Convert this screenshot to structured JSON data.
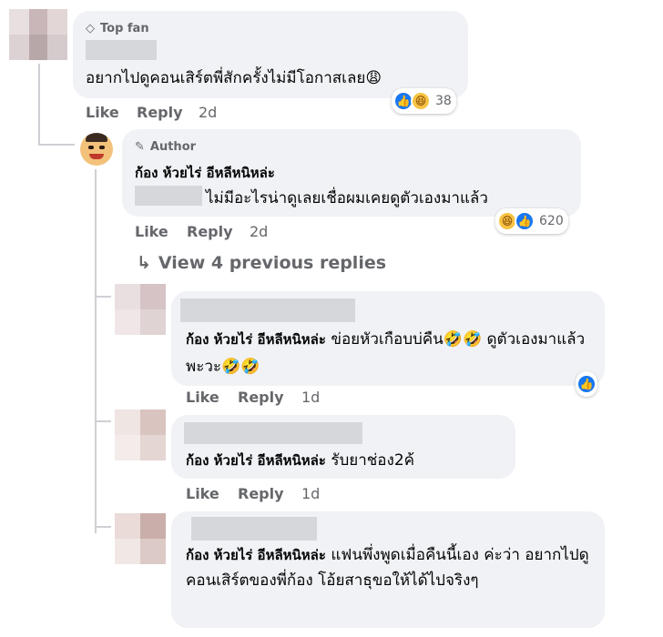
{
  "comments": [
    {
      "badge": "Top fan",
      "badge_icon": "diamond-icon",
      "text": "อยากไปดูคอนเสิร์ตพี่สักครั้งไม่มีโอกาสเลย😩",
      "reaction_count": "38",
      "reactions": [
        "like",
        "haha"
      ],
      "actions": {
        "like": "Like",
        "reply": "Reply",
        "time": "2d"
      }
    },
    {
      "badge": "Author",
      "badge_icon": "pencil-icon",
      "author": "ก้อง ห้วยไร่ อีหลีหนิหล่ะ",
      "text": "ไม่มีอะไรน่าดูเลยเชื่อผมเคยดูตัวเองมาแล้ว",
      "reaction_count": "620",
      "reactions": [
        "haha",
        "like"
      ],
      "actions": {
        "like": "Like",
        "reply": "Reply",
        "time": "2d"
      }
    }
  ],
  "view_previous": "View 4 previous replies",
  "replies": [
    {
      "mention": "ก้อง ห้วยไร่ อีหลีหนิหล่ะ",
      "text": "ข่อยหัวเกือบบ่คืน🤣🤣 ดูตัวเองมาแล้วพะวะ🤣🤣",
      "actions": {
        "like": "Like",
        "reply": "Reply",
        "time": "1d"
      },
      "reactions": [
        "like"
      ]
    },
    {
      "mention": "ก้อง ห้วยไร่ อีหลีหนิหล่ะ",
      "text": "รับยาช่อง2ค้",
      "actions": {
        "like": "Like",
        "reply": "Reply",
        "time": "1d"
      }
    },
    {
      "mention": "ก้อง ห้วยไร่ อีหลีหนิหล่ะ",
      "text": "แฟนพึ่งพูดเมื่อคืนนี้เอง ค่ะว่า อยากไปดูคอนเสิร์ตของพี่ก้อง โอ้ยสาธุขอให้ได้ไปจริงๆ"
    }
  ],
  "colors": {
    "bubble": "#f0f2f5",
    "secondary_text": "#65676b",
    "like_blue": "#1877f2",
    "haha_yellow": "#f7c342"
  }
}
